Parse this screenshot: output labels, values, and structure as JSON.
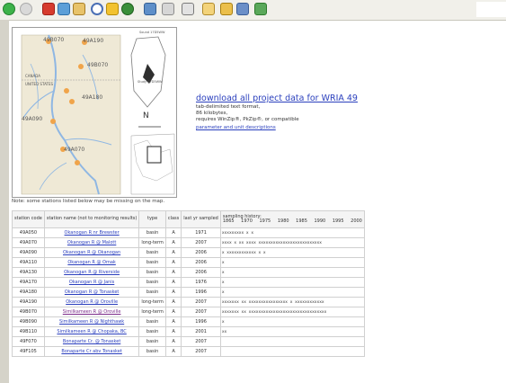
{
  "toolbar": {
    "icons": [
      "back-icon",
      "forward-icon",
      "stop-icon",
      "refresh-icon",
      "home-icon",
      "search-icon",
      "favorites-icon",
      "media-icon",
      "history-icon",
      "mail-icon",
      "print-icon",
      "edit-icon",
      "folder-icon",
      "discuss-icon",
      "messenger-icon"
    ]
  },
  "map": {
    "labels": {
      "l1": "49B070",
      "l2": "49A190",
      "l3": "49B070",
      "l4": "49A180",
      "l5": "49A090",
      "l6": "49A070",
      "river1": "Okanogan",
      "river2": "Similkameen",
      "river3": "Similkameen",
      "canada": "CANADA",
      "usa": "UNITED STATES",
      "inset_top": "Sound 17D5WW",
      "inset_mid": "Study 17D5WW",
      "km": "0  5  10 15"
    },
    "colors": {
      "stream": "#8fb7e3",
      "land": "#efe9d6",
      "station": "#f0a44a",
      "border": "#999999"
    }
  },
  "download": {
    "link": "download all project data for WRIA 49",
    "line1": "tab-delimited text format,",
    "line2": "86 kilobytes,",
    "line3": "requires WinZip®, PkZip®, or compatible",
    "param_link": "parameter and unit descriptions"
  },
  "note": "Note: some stations listed below may be missing on the map.",
  "table": {
    "headers": {
      "code": "station code",
      "name": "station name (not to monitoring results)",
      "type": "type",
      "class": "class",
      "last": "last yr sampled",
      "hist": "sampling history:",
      "years": [
        "1865",
        "1970",
        "1975",
        "1980",
        "1985",
        "1990",
        "1995",
        "2000"
      ]
    },
    "rows": [
      {
        "code": "49A050",
        "name": "Okanogan R nr Brewster",
        "type": "basin",
        "class": "A",
        "last": "1971",
        "hist": "xxxxxxxxx  x   x"
      },
      {
        "code": "49A070",
        "name": "Okanogan R @ Malott",
        "type": "long-term",
        "class": "A",
        "last": "2007",
        "hist": "          xxxx  x   xx  xxxx   xxxxxxxxxxxxxxxxxxxxxxxxxx"
      },
      {
        "code": "49A090",
        "name": "Okanogan R @ Okanogan",
        "type": "basin",
        "class": "A",
        "last": "2006",
        "hist": "                         x  xxxxxxxxxxxx          x        x"
      },
      {
        "code": "49A110",
        "name": "Okanogan R @ Omak",
        "type": "basin",
        "class": "A",
        "last": "2006",
        "hist": "                                                           x"
      },
      {
        "code": "49A130",
        "name": "Okanogan R @ Riverside",
        "type": "basin",
        "class": "A",
        "last": "2006",
        "hist": "                                                           x"
      },
      {
        "code": "49A170",
        "name": "Okanogan R @ Janis",
        "type": "basin",
        "class": "A",
        "last": "1976",
        "hist": "                  x"
      },
      {
        "code": "49A180",
        "name": "Okanogan R @ Tonasket",
        "type": "basin",
        "class": "A",
        "last": "1996",
        "hist": "                                             x"
      },
      {
        "code": "49A190",
        "name": "Okanogan R @ Oroville",
        "type": "long-term",
        "class": "A",
        "last": "2007",
        "hist": "xxxxxxx             xx  xxxxxxxxxxxxxxxx  x  xxxxxxxxxxxx"
      },
      {
        "code": "49B070",
        "name": "Similkameen R @ Oroville",
        "type": "long-term",
        "class": "A",
        "last": "2007",
        "hist": "xxxxxxx             xx  xxxxxxxxxxxxxxxxxxxxxxxxxxxxxxxx"
      },
      {
        "code": "49B090",
        "name": "Similkameen R @ Nighthawk",
        "type": "basin",
        "class": "A",
        "last": "1996",
        "hist": "                                             x"
      },
      {
        "code": "49B110",
        "name": "Similkameen R @ Chopaka, BC",
        "type": "basin",
        "class": "A",
        "last": "2001",
        "hist": "                                                  xx"
      },
      {
        "code": "49F070",
        "name": "Bonaparte Cr. @ Tonasket",
        "type": "basin",
        "class": "A",
        "last": "2007",
        "hist": ""
      },
      {
        "code": "49F105",
        "name": "Bonaparte Cr abv Tonasket",
        "type": "basin",
        "class": "A",
        "last": "2007",
        "hist": ""
      }
    ]
  }
}
